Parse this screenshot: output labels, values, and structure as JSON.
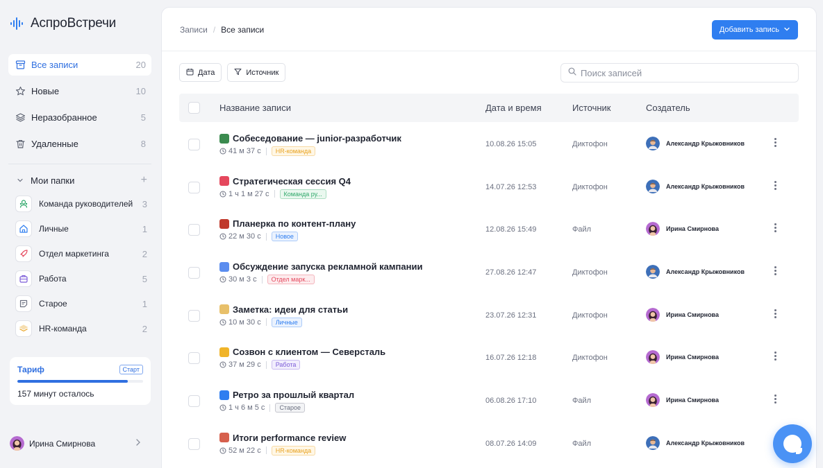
{
  "app": {
    "name": "АспроВстречи"
  },
  "nav": [
    {
      "label": "Все записи",
      "count": "20",
      "icon": "archive-icon",
      "active": true
    },
    {
      "label": "Новые",
      "count": "10",
      "icon": "star-icon",
      "active": false
    },
    {
      "label": "Неразобранное",
      "count": "5",
      "icon": "layers-icon",
      "active": false
    },
    {
      "label": "Удаленные",
      "count": "8",
      "icon": "trash-icon",
      "active": false
    }
  ],
  "folders_section": {
    "title": "Мои папки",
    "add": "+"
  },
  "folders": [
    {
      "label": "Команда руководителей",
      "count": "3",
      "icon": "users-icon",
      "color": "#2fa86a"
    },
    {
      "label": "Личные",
      "count": "1",
      "icon": "home-icon",
      "color": "#2f7ef0"
    },
    {
      "label": "Отдел маркетинга",
      "count": "2",
      "icon": "rocket-icon",
      "color": "#e5485d"
    },
    {
      "label": "Работа",
      "count": "5",
      "icon": "briefcase-icon",
      "color": "#7b5bd8"
    },
    {
      "label": "Старое",
      "count": "1",
      "icon": "note-icon",
      "color": "#6b7080"
    },
    {
      "label": "HR-команда",
      "count": "2",
      "icon": "stack-icon",
      "color": "#e8a220"
    }
  ],
  "tariff": {
    "title": "Тариф",
    "badge": "Старт",
    "progress": 0.88,
    "remaining": "157 минут осталось"
  },
  "user": {
    "name": "Ирина Смирнова"
  },
  "breadcrumb": {
    "root": "Записи",
    "sep": "/",
    "current": "Все записи"
  },
  "add_button": {
    "label": "Добавить запись"
  },
  "filters": {
    "date": "Дата",
    "source": "Источник"
  },
  "search": {
    "placeholder": "Поиск записей"
  },
  "table": {
    "columns": {
      "name": "Название записи",
      "datetime": "Дата и время",
      "source": "Источник",
      "creator": "Создатель"
    },
    "rows": [
      {
        "title": "Собеседование — junior-разработчик",
        "emoji": "#3b8b4f",
        "duration": "41 м 37 с",
        "tag": "HR-команда",
        "tag_color": "#e8a220",
        "tag_bg": "#fff7e6",
        "date": "10.08.26 15:05",
        "source": "Диктофон",
        "creator": "Александр Крыжовников",
        "creator_avatar": "male"
      },
      {
        "title": "Стратегическая сессия Q4",
        "emoji": "#e5485d",
        "duration": "1 ч 1 м 27 с",
        "tag": "Команда ру...",
        "tag_color": "#2fa86a",
        "tag_bg": "#eaf8ef",
        "date": "14.07.26 12:53",
        "source": "Диктофон",
        "creator": "Александр Крыжовников",
        "creator_avatar": "male"
      },
      {
        "title": "Планерка по контент-плану",
        "emoji": "#c0392b",
        "duration": "22 м 30 с",
        "tag": "Новое",
        "tag_color": "#2f7ef0",
        "tag_bg": "#eaf2fe",
        "date": "12.08.26 15:49",
        "source": "Файл",
        "creator": "Ирина Смирнова",
        "creator_avatar": "female"
      },
      {
        "title": "Обсуждение запуска рекламной кампании",
        "emoji": "#5b8def",
        "duration": "30 м 3 с",
        "tag": "Отдел марк...",
        "tag_color": "#e5485d",
        "tag_bg": "#fdecee",
        "date": "27.08.26 12:47",
        "source": "Диктофон",
        "creator": "Александр Крыжовников",
        "creator_avatar": "male"
      },
      {
        "title": "Заметка: идеи для статьи",
        "emoji": "#e8c06a",
        "duration": "10 м 30 с",
        "tag": "Личные",
        "tag_color": "#2f7ef0",
        "tag_bg": "#eaf2fe",
        "date": "23.07.26 12:31",
        "source": "Диктофон",
        "creator": "Ирина Смирнова",
        "creator_avatar": "female"
      },
      {
        "title": "Созвон с клиентом — Северсталь",
        "emoji": "#f0b429",
        "duration": "37 м 29 с",
        "tag": "Работа",
        "tag_color": "#7b5bd8",
        "tag_bg": "#f2eefd",
        "date": "16.07.26 12:18",
        "source": "Диктофон",
        "creator": "Ирина Смирнова",
        "creator_avatar": "female"
      },
      {
        "title": "Ретро за прошлый квартал",
        "emoji": "#2f7ef0",
        "duration": "1 ч 6 м 5 с",
        "tag": "Старое",
        "tag_color": "#6b7080",
        "tag_bg": "#f3f4f6",
        "date": "06.08.26 17:10",
        "source": "Файл",
        "creator": "Ирина Смирнова",
        "creator_avatar": "female"
      },
      {
        "title": "Итоги performance review",
        "emoji": "#d6604d",
        "duration": "52 м 22 с",
        "tag": "HR-команда",
        "tag_color": "#e8a220",
        "tag_bg": "#fff7e6",
        "date": "08.07.26 14:09",
        "source": "Файл",
        "creator": "Александр Крыжовников",
        "creator_avatar": "male"
      }
    ]
  }
}
